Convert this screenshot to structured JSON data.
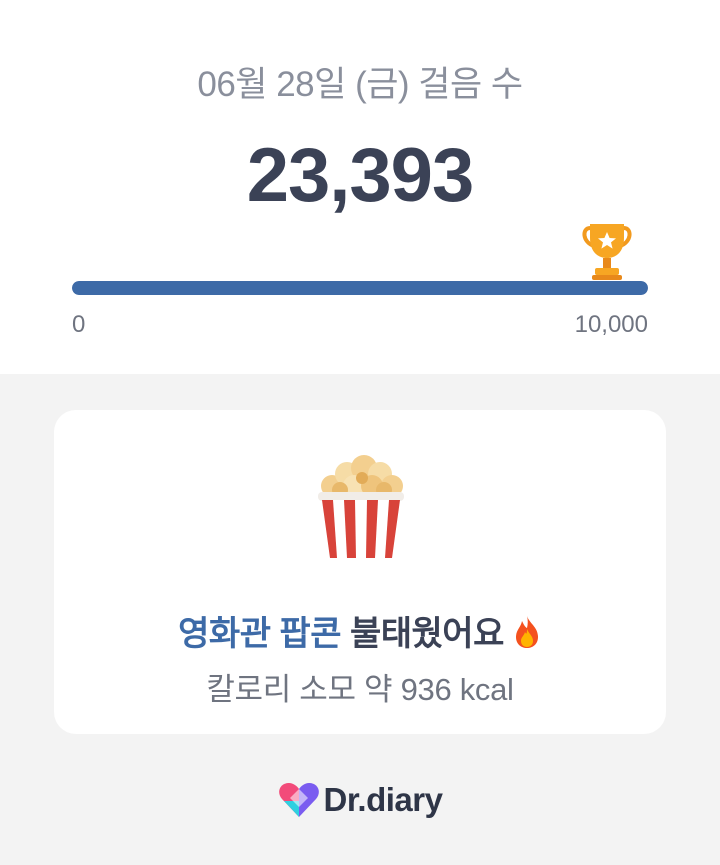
{
  "steps_panel": {
    "date_title": "06월 28일 (금) 걸음 수",
    "step_count": "23,393",
    "progress": {
      "min_label": "0",
      "max_label": "10,000",
      "current": 23393,
      "goal": 10000,
      "fill_fraction": 1.0,
      "color": "#3d6aa7"
    },
    "goal_icon": "trophy-icon"
  },
  "burn_card": {
    "icon": "popcorn-icon",
    "headline_accent": "영화관 팝콘",
    "headline_rest": " 불태웠어요",
    "headline_icon": "fire-icon",
    "calories_text": "칼로리 소모 약 936 kcal"
  },
  "footer": {
    "brand_name": "Dr.diary",
    "brand_icon": "heart-logo-icon"
  },
  "colors": {
    "accent": "#3d6aa7",
    "text_dark": "#3b4256",
    "text_muted": "#8a8f9c",
    "background": "#f3f3f3"
  }
}
